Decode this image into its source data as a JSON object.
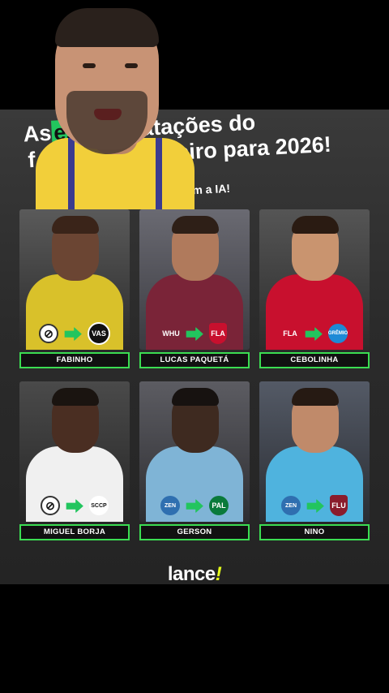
{
  "headline": {
    "line1_pre": "As",
    "line1_highlight": "es",
    "line1_post": " contratações do",
    "line2_pre": "f",
    "line2_post": "ileiro para 2026!",
    "subline": "do com a IA!"
  },
  "cards": [
    {
      "name": "FABINHO",
      "badge_from": "⊘",
      "badge_to": "VAS"
    },
    {
      "name": "LUCAS PAQUETÁ",
      "badge_from": "WHU",
      "badge_to": "FLA"
    },
    {
      "name": "CEBOLINHA",
      "badge_from": "FLA",
      "badge_to": "GRÊMIO"
    },
    {
      "name": "MIGUEL BORJA",
      "badge_from": "⊘",
      "badge_to": "SCCP"
    },
    {
      "name": "GERSON",
      "badge_from": "ZEN",
      "badge_to": "PAL"
    },
    {
      "name": "NINO",
      "badge_from": "ZEN",
      "badge_to": "FLU"
    }
  ],
  "logo": {
    "text": "lance",
    "mark": "!"
  },
  "colors": {
    "accent": "#22c55e",
    "logo_mark": "#e6ff1a"
  }
}
